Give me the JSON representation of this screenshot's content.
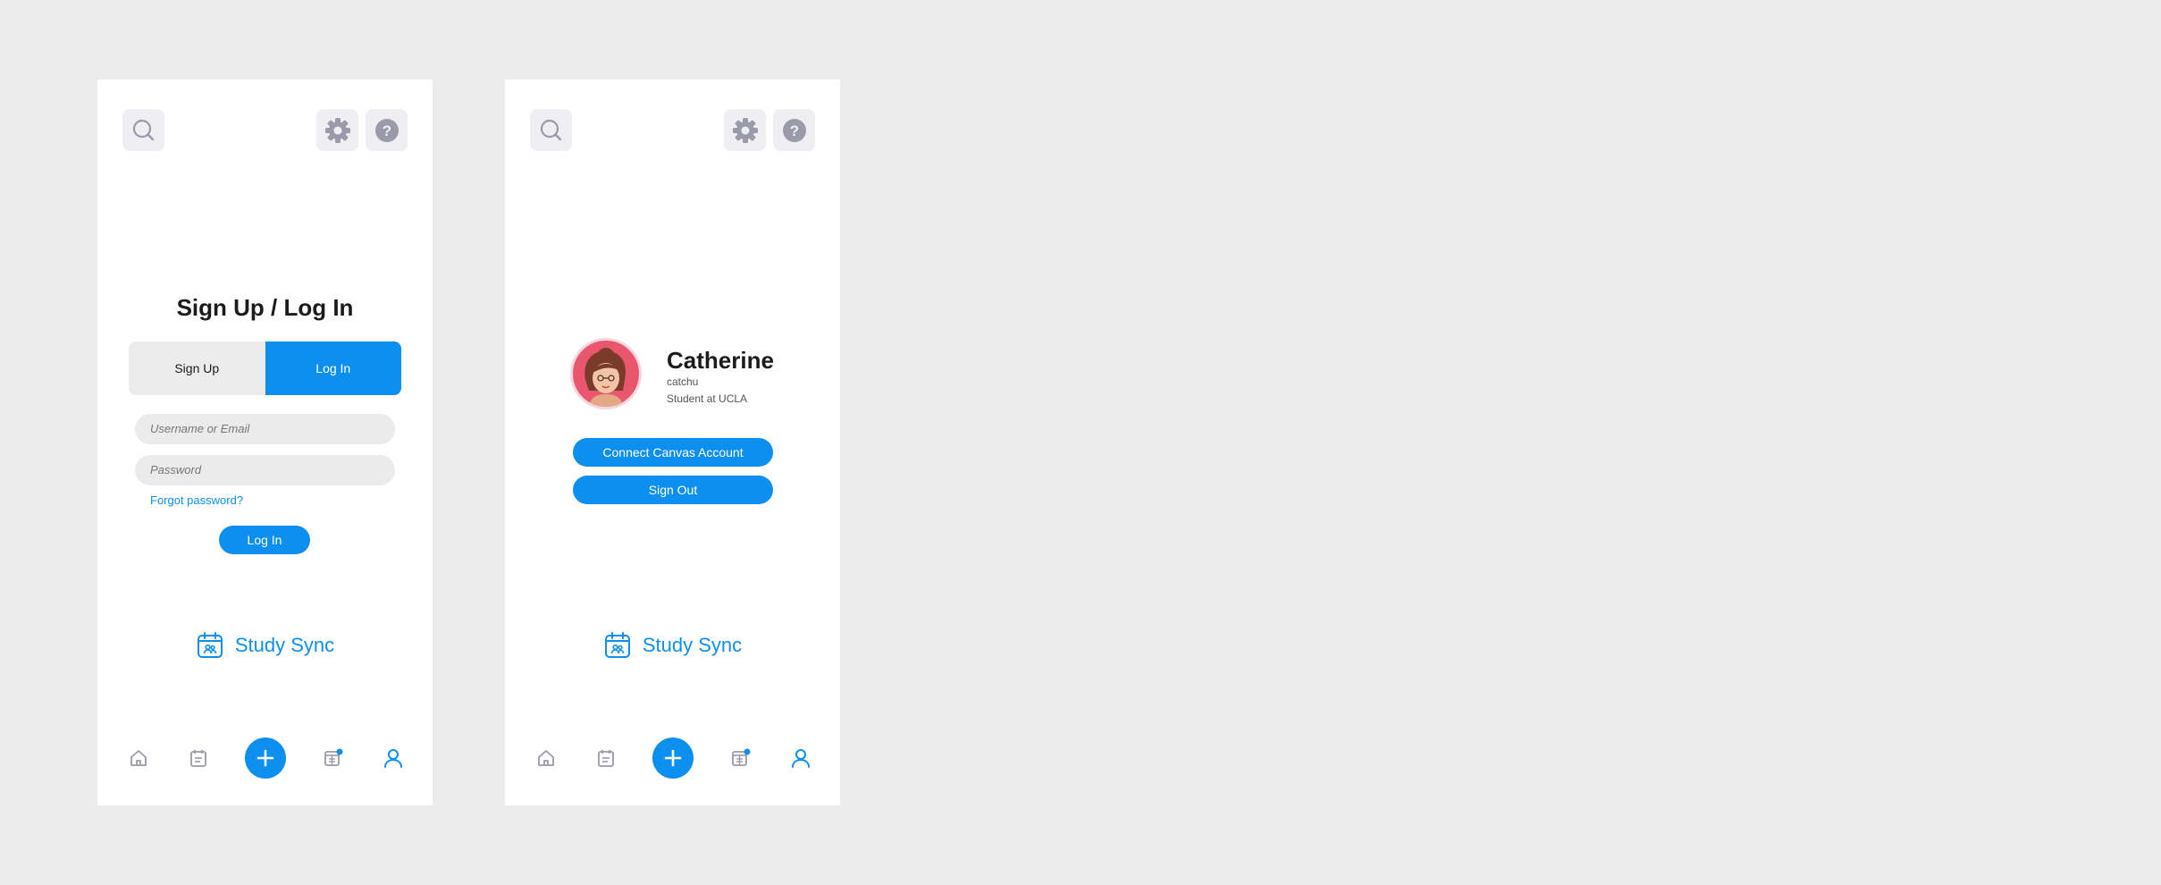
{
  "login_screen": {
    "title": "Sign Up / Log In",
    "tabs": [
      {
        "label": "Sign Up",
        "selected": false
      },
      {
        "label": "Log In",
        "selected": true
      }
    ],
    "username_placeholder": "Username or Email",
    "password_placeholder": "Password",
    "forgot_label": "Forgot password?",
    "login_button": "Log In"
  },
  "profile_screen": {
    "name": "Catherine",
    "username": "catchu",
    "subtitle": "Student at UCLA",
    "connect_button": "Connect Canvas Account",
    "signout_button": "Sign Out"
  },
  "brand": {
    "name": "Study Sync"
  },
  "top_bar": {
    "icons": [
      "search-icon",
      "gear-icon",
      "help-icon"
    ]
  },
  "bottom_nav": {
    "icons": [
      "home-icon",
      "notes-icon",
      "add-icon",
      "calendar-icon",
      "profile-icon"
    ],
    "active": "profile-icon"
  },
  "colors": {
    "accent": "#0d8ff0",
    "background": "#ececec",
    "icon_gray": "#9a9aa8",
    "button_bg": "#efeff3"
  }
}
